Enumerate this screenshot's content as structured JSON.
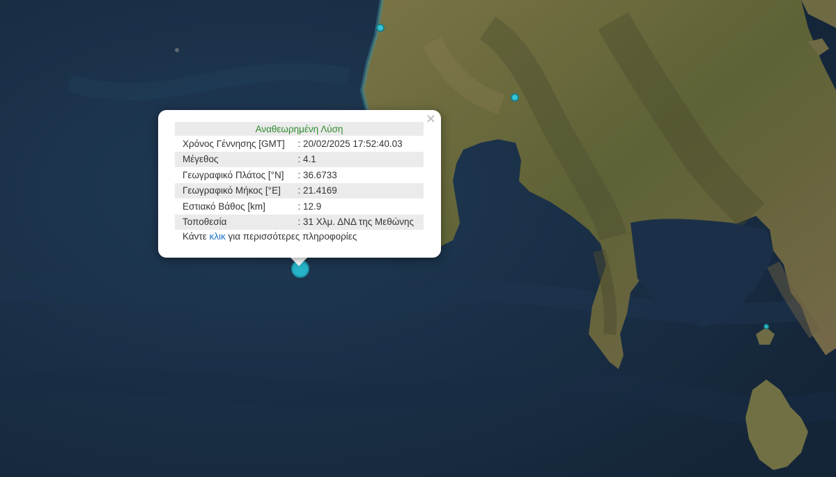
{
  "popup": {
    "title": "Αναθεωρημένη Λύση",
    "rows": [
      {
        "label": "Χρόνος Γέννησης [GMT]",
        "value": ": 20/02/2025 17:52:40.03"
      },
      {
        "label": "Μέγεθος",
        "value": ": 4.1"
      },
      {
        "label": "Γεωγραφικό Πλάτος [°N]",
        "value": ": 36.6733"
      },
      {
        "label": "Γεωγραφικό Μήκος [°E]",
        "value": ": 21.4169"
      },
      {
        "label": "Εστιακό Βάθος [km]",
        "value": ": 12.9"
      },
      {
        "label": "Τοποθεσία",
        "value": ": 31 Χλμ. ΔΝΔ της Μεθώνης"
      }
    ],
    "more_prefix": "Κάντε ",
    "more_link": "κλικ",
    "more_suffix": " για περισσότερες πληροφορίες",
    "close_label": "×"
  },
  "colors": {
    "sea": "#1a2d44",
    "land": "#6b6a40",
    "title_green": "#2e8b2e",
    "link_blue": "#1a73c7",
    "marker": "#27b3c7"
  },
  "icons": {
    "close": "close-icon",
    "marker": "earthquake-marker-icon"
  }
}
